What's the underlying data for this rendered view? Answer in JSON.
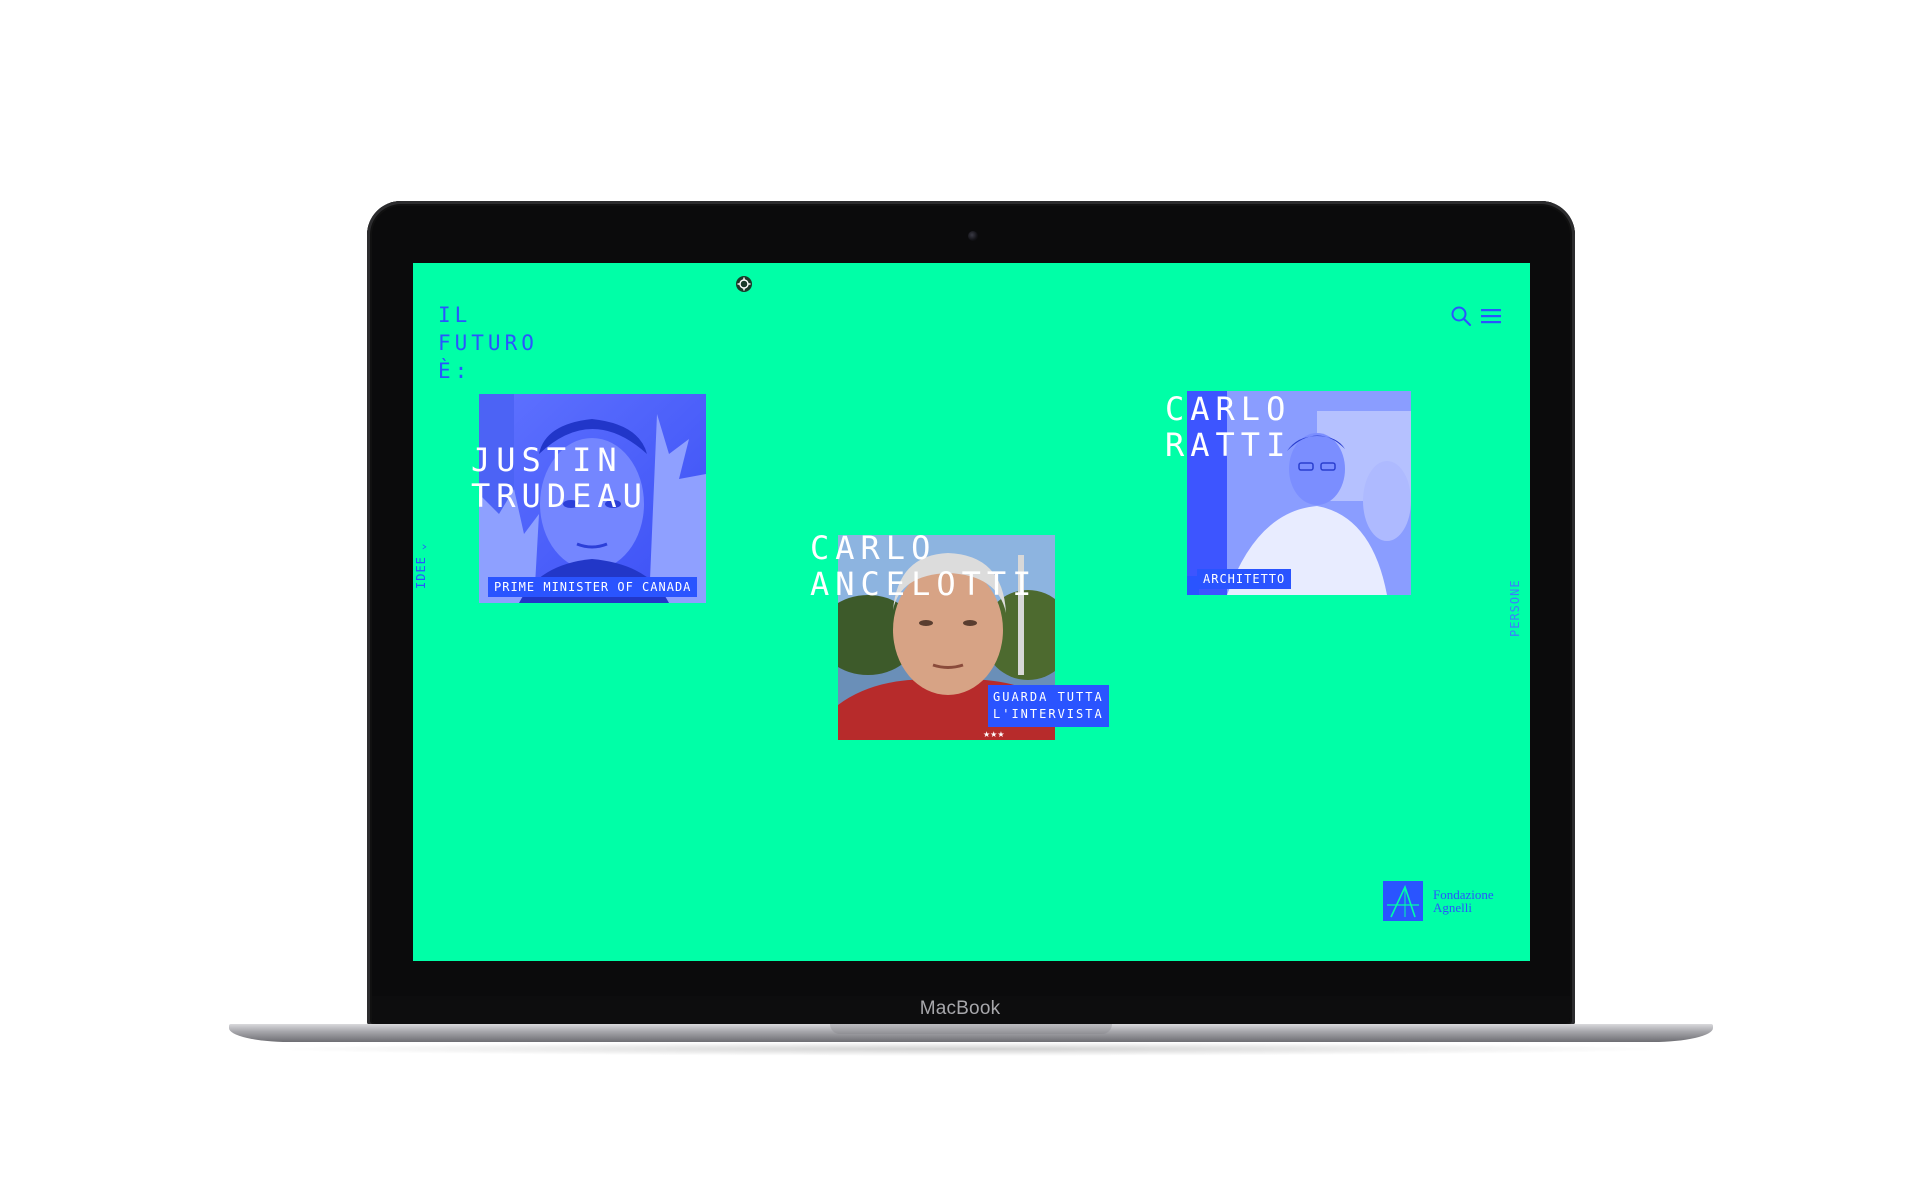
{
  "device": {
    "brand": "MacBook"
  },
  "site": {
    "title_lines": [
      "IL",
      "FUTURO",
      "È:"
    ],
    "nav_left": "IDEE",
    "nav_right": "PERSONE",
    "cta_lines": [
      "GUARDA TUTTA",
      "L'INTERVISTA"
    ],
    "footer_logo_lines": [
      "Fondazione",
      "Agnelli"
    ]
  },
  "cards": [
    {
      "name_lines": [
        "JUSTIN",
        "TRUDEAU"
      ],
      "role": "PRIME MINISTER OF CANADA"
    },
    {
      "name_lines": [
        "CARLO",
        "ANCELOTTI"
      ],
      "role": ""
    },
    {
      "name_lines": [
        "CARLO",
        "RATTI"
      ],
      "role": "ARCHITETTO"
    }
  ],
  "colors": {
    "background": "#00ffa7",
    "accent": "#2a54ff",
    "text_on_accent": "#ffffff"
  },
  "icons": [
    "target-icon",
    "search-icon",
    "menu-icon",
    "chevron-left-icon",
    "fondazione-agnelli-logo"
  ]
}
